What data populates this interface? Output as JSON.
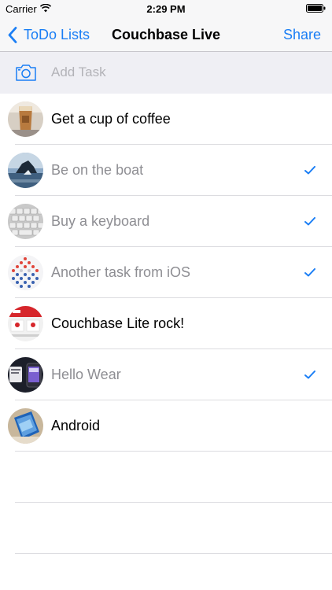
{
  "status_bar": {
    "carrier": "Carrier",
    "time": "2:29 PM",
    "icons": [
      "wifi-icon",
      "battery-icon"
    ]
  },
  "nav": {
    "back_label": "ToDo Lists",
    "back_icon": "chevron-left-icon",
    "title": "Couchbase Live",
    "share_label": "Share",
    "accent_color": "#1a7ef5"
  },
  "add_task": {
    "icon": "camera-icon",
    "placeholder": "Add Task",
    "value": ""
  },
  "tasks": [
    {
      "title": "Get a cup of coffee",
      "checked": false,
      "thumb": "coffee-cup-photo"
    },
    {
      "title": "Be on the boat",
      "checked": true,
      "thumb": "boat-photo"
    },
    {
      "title": "Buy a keyboard",
      "checked": true,
      "thumb": "keyboard-photo"
    },
    {
      "title": "Another task from iOS",
      "checked": true,
      "thumb": "dots-pattern-photo"
    },
    {
      "title": "Couchbase Lite rock!",
      "checked": false,
      "thumb": "app-screenshot-photo"
    },
    {
      "title": "Hello Wear",
      "checked": true,
      "thumb": "smartwatch-photo"
    },
    {
      "title": "Android",
      "checked": false,
      "thumb": "phone-photo"
    }
  ]
}
